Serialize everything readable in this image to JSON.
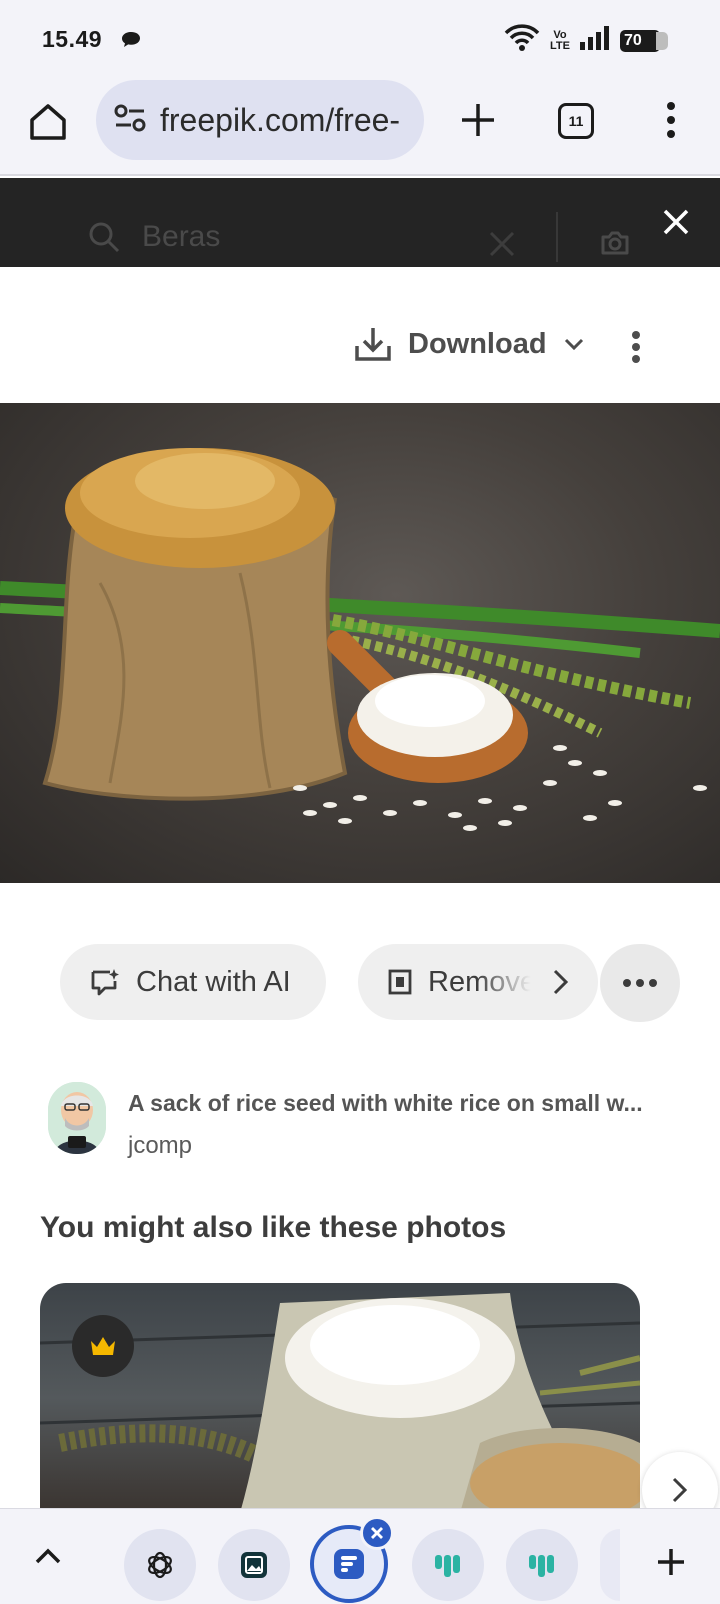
{
  "status_bar": {
    "time": "15.49",
    "volte_top": "Vo",
    "volte_bottom": "LTE",
    "battery": "70"
  },
  "browser": {
    "url": "freepik.com/free-",
    "tab_count": "11"
  },
  "search": {
    "query": "Beras"
  },
  "actions": {
    "download_label": "Download"
  },
  "chips": {
    "chat_ai": "Chat with AI",
    "remove": "Remove"
  },
  "photo": {
    "title": "A sack of rice seed with white rice on small w...",
    "author": "jcomp"
  },
  "related": {
    "heading": "You might also like these photos"
  },
  "colors": {
    "accent": "#2d5bc2",
    "header_dark": "#242424",
    "premium_crown": "#f5b800"
  }
}
